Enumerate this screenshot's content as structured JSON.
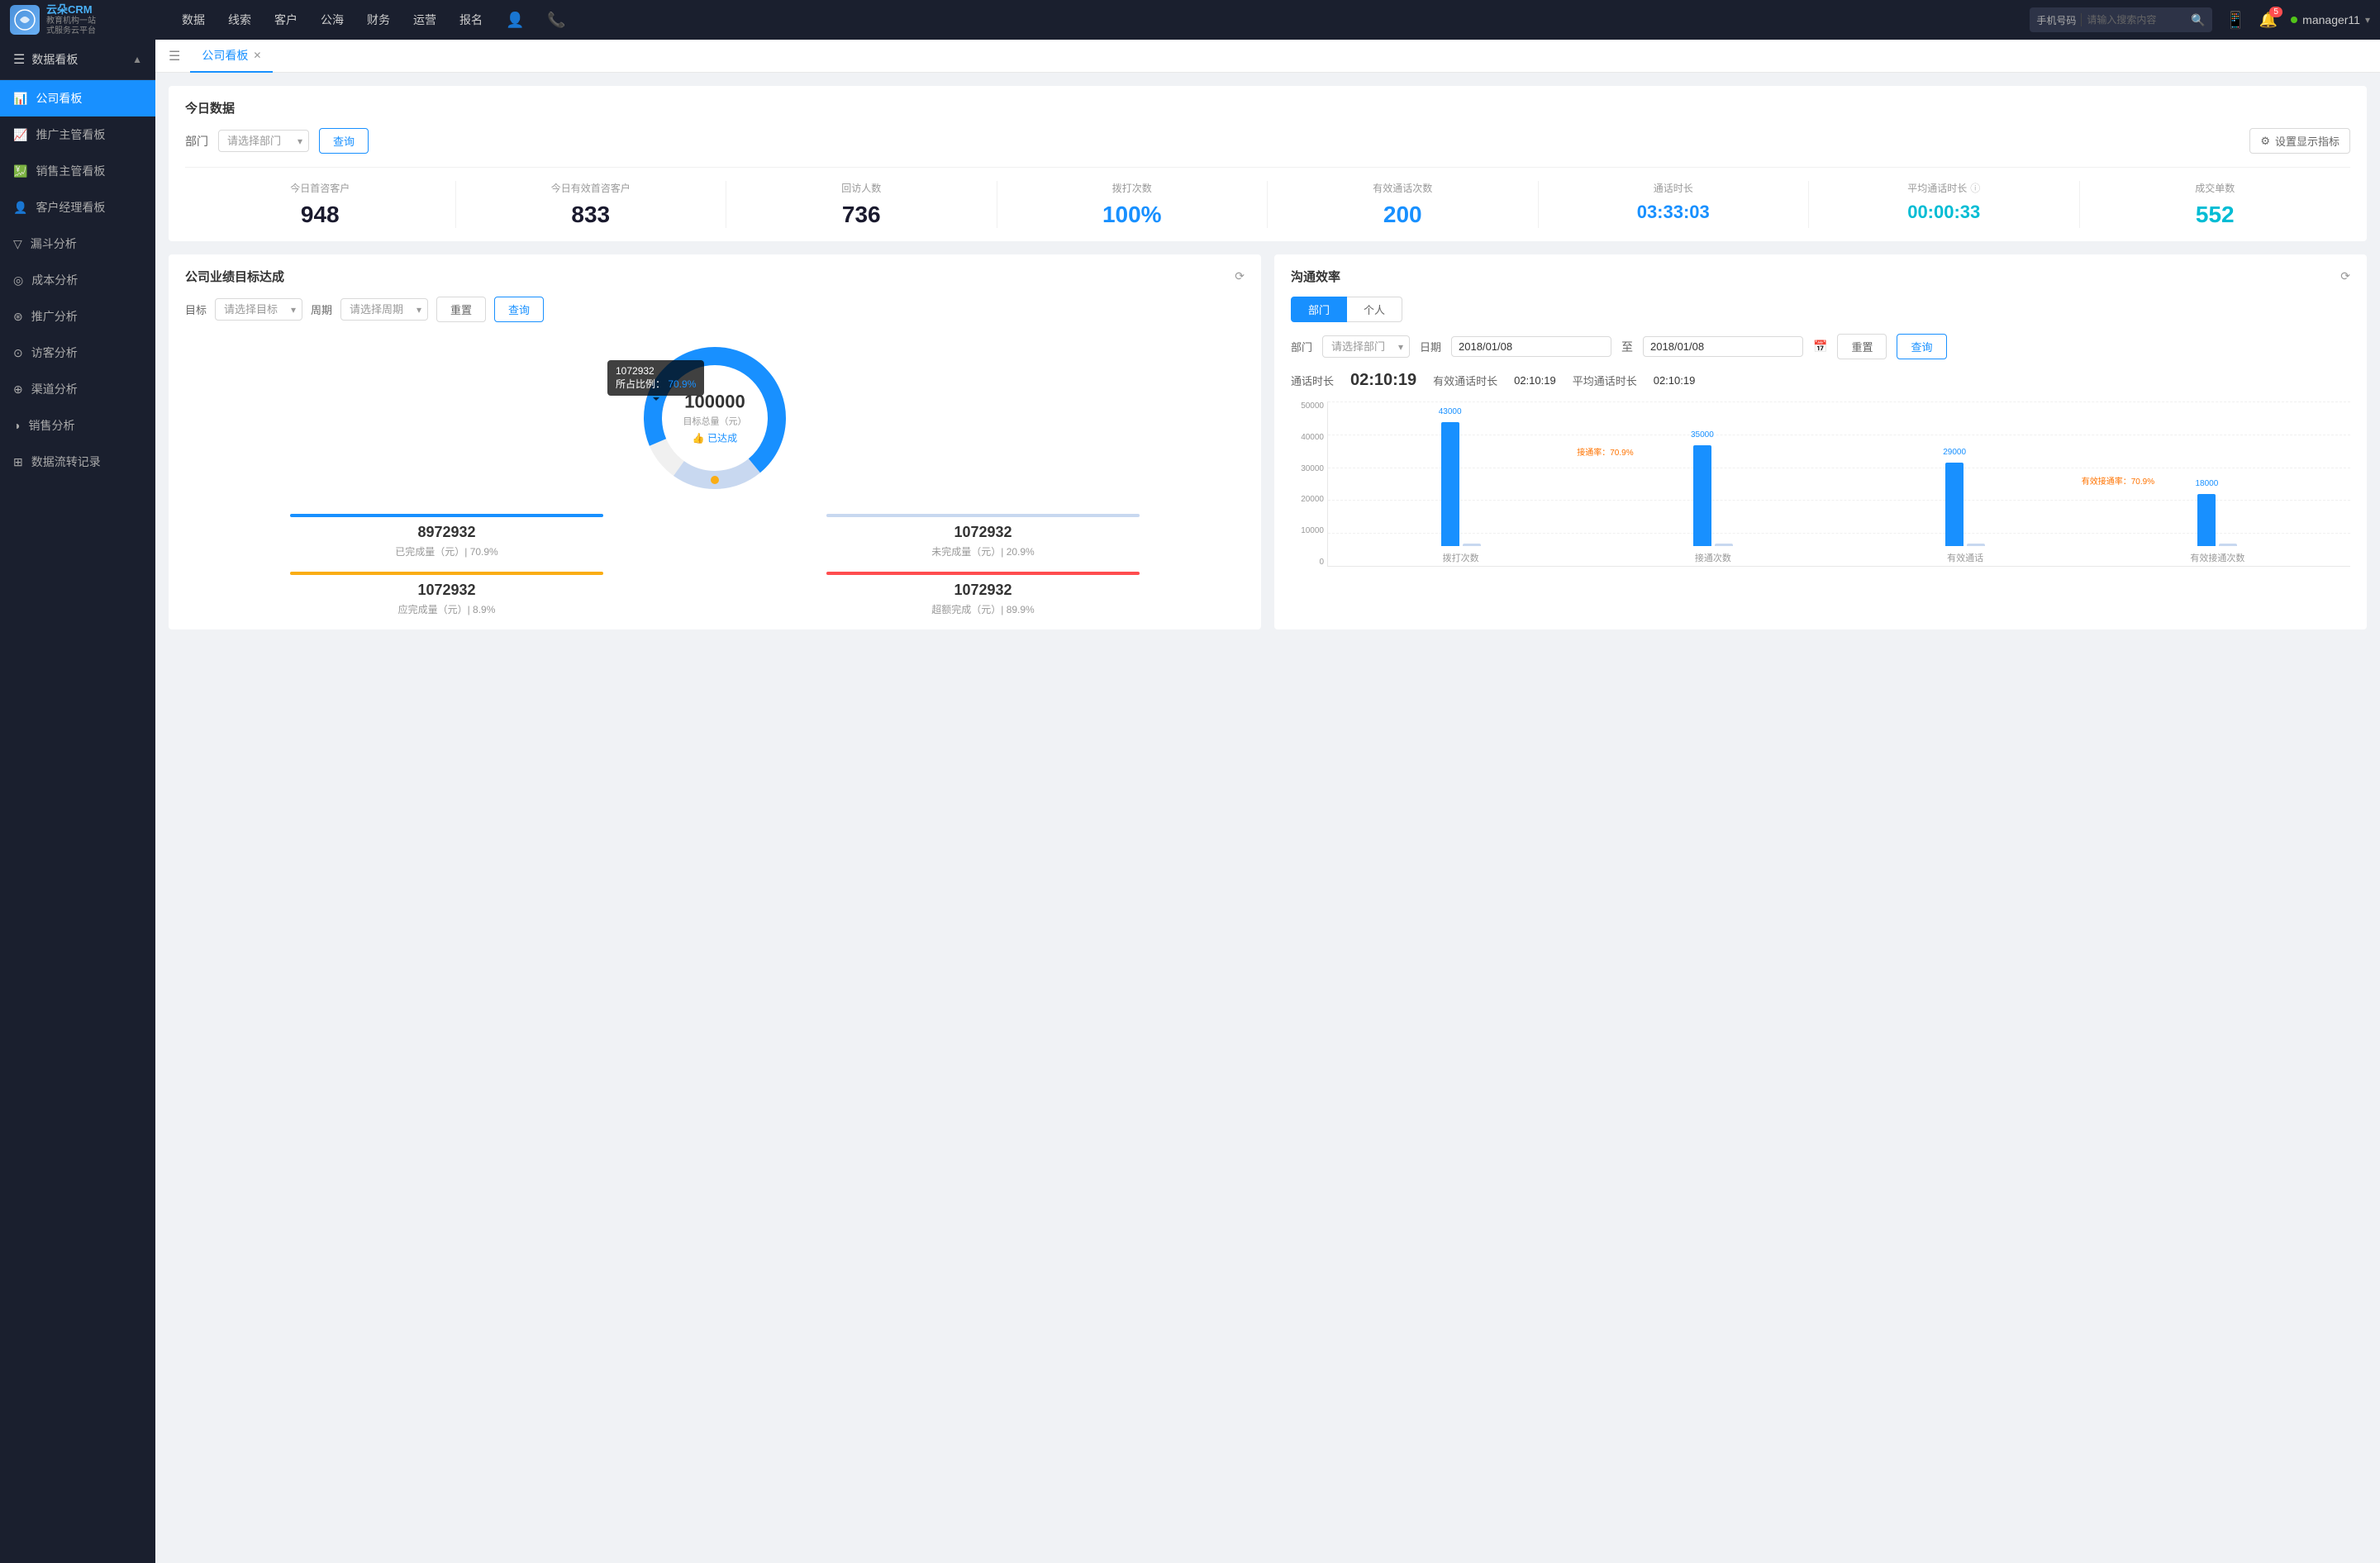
{
  "brand": {
    "name": "云朵CRM",
    "tagline": "教育机构一站\n式服务云平台"
  },
  "topNav": {
    "items": [
      "数据",
      "线索",
      "客户",
      "公海",
      "财务",
      "运营",
      "报名"
    ],
    "search": {
      "type": "手机号码",
      "placeholder": "请输入搜索内容"
    },
    "notifications": 5,
    "user": "manager11"
  },
  "sidebar": {
    "header": "数据看板",
    "items": [
      {
        "label": "公司看板",
        "active": true,
        "icon": "📊"
      },
      {
        "label": "推广主管看板",
        "active": false,
        "icon": "📈"
      },
      {
        "label": "销售主管看板",
        "active": false,
        "icon": "💹"
      },
      {
        "label": "客户经理看板",
        "active": false,
        "icon": "👤"
      },
      {
        "label": "漏斗分析",
        "active": false,
        "icon": "⬇"
      },
      {
        "label": "成本分析",
        "active": false,
        "icon": "💰"
      },
      {
        "label": "推广分析",
        "active": false,
        "icon": "📣"
      },
      {
        "label": "访客分析",
        "active": false,
        "icon": "👁"
      },
      {
        "label": "渠道分析",
        "active": false,
        "icon": "🔗"
      },
      {
        "label": "销售分析",
        "active": false,
        "icon": "📉"
      },
      {
        "label": "数据流转记录",
        "active": false,
        "icon": "🔄"
      }
    ]
  },
  "tabs": [
    {
      "label": "公司看板",
      "active": true,
      "closable": true
    }
  ],
  "todayData": {
    "title": "今日数据",
    "filter": {
      "label": "部门",
      "placeholder": "请选择部门",
      "queryBtn": "查询",
      "settingsBtn": "设置显示指标"
    },
    "stats": [
      {
        "label": "今日首咨客户",
        "value": "948",
        "color": "dark"
      },
      {
        "label": "今日有效首咨客户",
        "value": "833",
        "color": "dark"
      },
      {
        "label": "回访人数",
        "value": "736",
        "color": "dark"
      },
      {
        "label": "拨打次数",
        "value": "100%",
        "color": "blue"
      },
      {
        "label": "有效通话次数",
        "value": "200",
        "color": "blue"
      },
      {
        "label": "通话时长",
        "value": "03:33:03",
        "color": "blue"
      },
      {
        "label": "平均通话时长",
        "value": "00:00:33",
        "color": "cyan"
      },
      {
        "label": "成交单数",
        "value": "552",
        "color": "cyan"
      }
    ]
  },
  "goalChart": {
    "title": "公司业绩目标达成",
    "filters": {
      "targetLabel": "目标",
      "targetPlaceholder": "请选择目标",
      "periodLabel": "周期",
      "periodPlaceholder": "请选择周期",
      "resetBtn": "重置",
      "queryBtn": "查询"
    },
    "tooltip": {
      "value": "1072932",
      "percent": "70.9%",
      "label": "所占比例："
    },
    "donut": {
      "centerValue": "100000",
      "centerLabel": "目标总量（元）",
      "achieved": "👍 已达成",
      "bluePercent": 70.9,
      "orangePercent": 8.9,
      "grayPercent": 20.9
    },
    "stats": [
      {
        "label": "已完成量（元）| 70.9%",
        "value": "8972932",
        "barColor": "#1890ff",
        "barWidth": "70%"
      },
      {
        "label": "未完成量（元）| 20.9%",
        "value": "1072932",
        "barColor": "#c8d8f0",
        "barWidth": "50%"
      },
      {
        "label": "应完成量（元）| 8.9%",
        "value": "1072932",
        "barColor": "#faad14",
        "barWidth": "40%"
      },
      {
        "label": "超额完成（元）| 89.9%",
        "value": "1072932",
        "barColor": "#ff4d4f",
        "barWidth": "45%"
      }
    ]
  },
  "commChart": {
    "title": "沟通效率",
    "tabs": [
      "部门",
      "个人"
    ],
    "activeTab": 0,
    "filters": {
      "deptLabel": "部门",
      "deptPlaceholder": "请选择部门",
      "dateLabel": "日期",
      "dateFrom": "2018/01/08",
      "dateTo": "2018/01/08",
      "resetBtn": "重置",
      "queryBtn": "查询"
    },
    "callStats": {
      "durationLabel": "通话时长",
      "duration": "02:10:19",
      "effectiveDurationLabel": "有效通话时长",
      "effectiveDuration": "02:10:19",
      "avgDurationLabel": "平均通话时长",
      "avgDuration": "02:10:19"
    },
    "chart": {
      "yAxisLabels": [
        "50000",
        "40000",
        "30000",
        "20000",
        "10000",
        "0"
      ],
      "groups": [
        {
          "label": "拨打次数",
          "bars": [
            {
              "value": 43000,
              "label": "43000",
              "color": "blue",
              "height": 86
            },
            {
              "value": 0,
              "label": "",
              "color": "light-blue",
              "height": 5
            }
          ]
        },
        {
          "label": "接通次数",
          "annotation": "接通率：70.9%",
          "bars": [
            {
              "value": 35000,
              "label": "35000",
              "color": "blue",
              "height": 70
            },
            {
              "value": 0,
              "label": "",
              "color": "light-blue",
              "height": 5
            }
          ]
        },
        {
          "label": "有效通话",
          "bars": [
            {
              "value": 29000,
              "label": "29000",
              "color": "blue",
              "height": 58
            },
            {
              "value": 0,
              "label": "",
              "color": "light-blue",
              "height": 5
            }
          ]
        },
        {
          "label": "有效接通次数",
          "annotation": "有效接通率：70.9%",
          "bars": [
            {
              "value": 18000,
              "label": "18000",
              "color": "blue",
              "height": 36
            },
            {
              "value": 0,
              "label": "",
              "color": "light-blue",
              "height": 5
            }
          ]
        }
      ]
    }
  }
}
